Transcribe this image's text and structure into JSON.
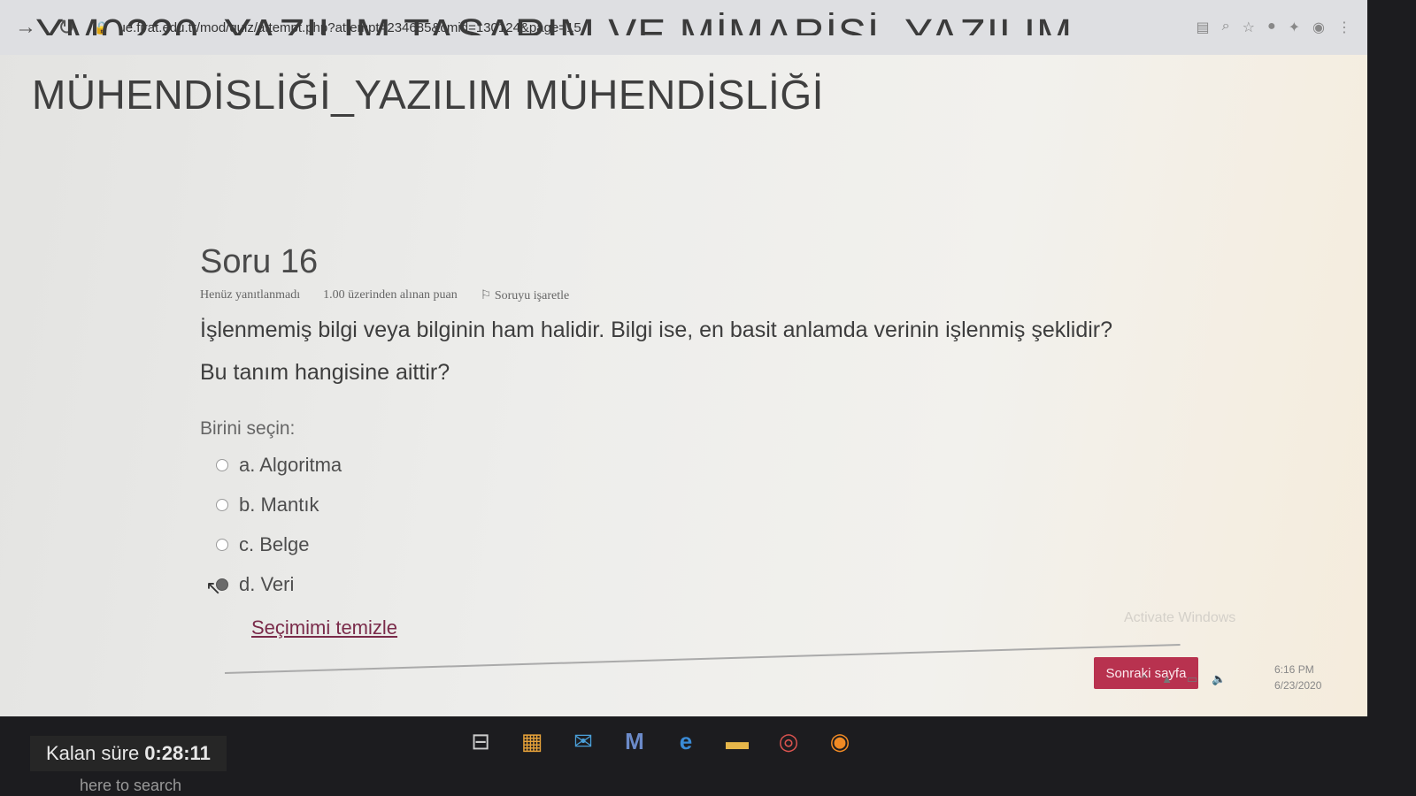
{
  "browser": {
    "url": "ue.firat.edu.tr/mod/quiz/attempt.php?attempt=234685&cmid=130124&page=15",
    "back_icon": "arrow-right-icon",
    "reload_icon": "reload-icon"
  },
  "course": {
    "title_top_fragment": "YM0220_YAZILIM TASARIM VE MİMARİSİ_YAZILIM",
    "title": "MÜHENDİSLİĞİ_YAZILIM MÜHENDİSLİĞİ"
  },
  "question": {
    "number": "Soru 16",
    "status": "Henüz yanıtlanmadı",
    "points": "1.00 üzerinden alınan puan",
    "flag": "Soruyu işaretle",
    "text_line1": "İşlenmemiş bilgi veya bilginin ham halidir. Bilgi ise, en basit anlamda verinin işlenmiş şeklidir?",
    "text_line2": "Bu tanım hangisine aittir?",
    "choose_label": "Birini seçin:",
    "options": [
      {
        "label": "a. Algoritma",
        "selected": false
      },
      {
        "label": "b. Mantık",
        "selected": false
      },
      {
        "label": "c. Belge",
        "selected": false
      },
      {
        "label": "d. Veri",
        "selected": true
      }
    ],
    "clear_label": "Seçimimi temizle"
  },
  "navigation": {
    "next_page": "Sonraki sayfa"
  },
  "timer": {
    "label": "Kalan süre",
    "value": "0:28:11"
  },
  "windows": {
    "activate_text": "Activate Windows",
    "clock_time": "6:16 PM",
    "clock_date": "6/23/2020",
    "search_text": "here to search"
  },
  "colors": {
    "next_button": "#b8324f",
    "link": "#7a2b4a"
  }
}
